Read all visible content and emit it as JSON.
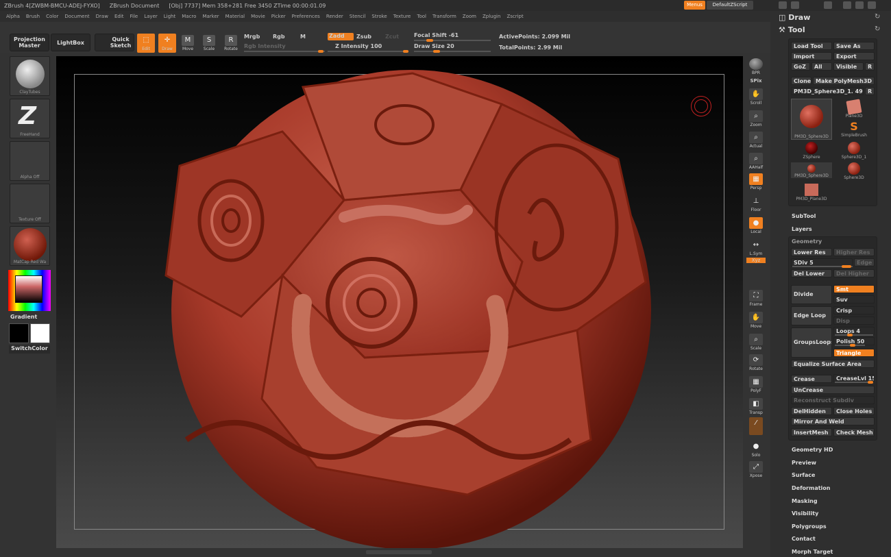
{
  "titlebar": {
    "app": "ZBrush 4[ZWBM-BMCU-ADEJ-FYXO]",
    "doc": "ZBrush Document",
    "stats": "[Obj] 7737] Mem 358+281  Free 3450  ZTime 00:00:01.09",
    "menus_btn": "Menus",
    "script_btn": "DefaultZScript"
  },
  "menubar": [
    "Alpha",
    "Brush",
    "Color",
    "Document",
    "Draw",
    "Edit",
    "File",
    "Layer",
    "Light",
    "Macro",
    "Marker",
    "Material",
    "Movie",
    "Picker",
    "Preferences",
    "Render",
    "Stencil",
    "Stroke",
    "Texture",
    "Tool",
    "Transform",
    "Zoom",
    "Zplugin",
    "Zscript"
  ],
  "toolbar": {
    "projection_master": "Projection Master",
    "lightbox": "LightBox",
    "quick_sketch": "Quick Sketch",
    "edit": "Edit",
    "draw": "Draw",
    "move": "Move",
    "scale": "Scale",
    "rotate": "Rotate",
    "mrgb": "Mrgb",
    "rgb": "Rgb",
    "m": "M",
    "rgb_intensity": "Rgb Intensity",
    "zadd": "Zadd",
    "zsub": "Zsub",
    "zcut": "Zcut",
    "z_intensity": "Z Intensity 100",
    "focal_shift": "Focal Shift -61",
    "draw_size": "Draw Size 20",
    "active_points": "ActivePoints: 2.099 Mil",
    "total_points": "TotalPoints: 2.99 Mil"
  },
  "leftshelf": {
    "brush": "ClayTubes",
    "stroke": "FreeHand",
    "alpha": "Alpha Off",
    "texture": "Texture Off",
    "material": "MatCap Red Wa",
    "gradient": "Gradient",
    "switchcolor": "SwitchColor"
  },
  "rightshelf": [
    "BPR",
    "SPix",
    "Scroll",
    "Zoom",
    "Actual",
    "AAHalf",
    "Persp",
    "Floor",
    "Local",
    "L.Sym",
    "Xyz",
    "Frame",
    "Move",
    "Scale",
    "Rotate",
    "PolyF",
    "Transp",
    "Ghost",
    "Solo",
    "Xpose"
  ],
  "palette": {
    "draw": "Draw",
    "tool": "Tool",
    "load_tool": "Load Tool",
    "save_as": "Save As",
    "import": "Import",
    "export": "Export",
    "goz": "GoZ",
    "all": "All",
    "visible": "Visible",
    "r": "R",
    "clone": "Clone",
    "make_polymesh": "Make PolyMesh3D",
    "current_tool": "PM3D_Sphere3D_1. 49",
    "tools": [
      "PM3D_Sphere3D",
      "Plane3D",
      "SimpleBrush",
      "ZSphere",
      "Sphere3D_1",
      "PM3D_Sphere3D",
      "Sphere3D",
      "PM3D_Plane3D"
    ],
    "subtool": "SubTool",
    "layers": "Layers",
    "geometry": "Geometry",
    "lower_res": "Lower Res",
    "higher_res": "Higher Res",
    "sdiv": "SDiv 5",
    "edge": "Edge",
    "del_lower": "Del Lower",
    "del_higher": "Del Higher",
    "divide": "Divide",
    "smt": "Smt",
    "suv": "Suv",
    "edge_loop": "Edge Loop",
    "crisp": "Crisp",
    "disp": "Disp",
    "groupsloops": "GroupsLoops",
    "loops": "Loops 4",
    "polish": "Polish 50",
    "triangle": "Triangle",
    "equalize": "Equalize Surface Area",
    "crease": "Crease",
    "creaselvl": "CreaseLvl 15",
    "uncrease": "UnCrease",
    "reconstruct": "Reconstruct Subdiv",
    "delhidden": "DelHidden",
    "close_holes": "Close Holes",
    "mirror_weld": "Mirror And Weld",
    "insertmesh": "InsertMesh",
    "check_mesh": "Check Mesh",
    "sections": [
      "Geometry HD",
      "Preview",
      "Surface",
      "Deformation",
      "Masking",
      "Visibility",
      "Polygroups",
      "Contact",
      "Morph Target"
    ]
  },
  "colors": {
    "accent": "#f08020",
    "model": "#a83a2a"
  }
}
